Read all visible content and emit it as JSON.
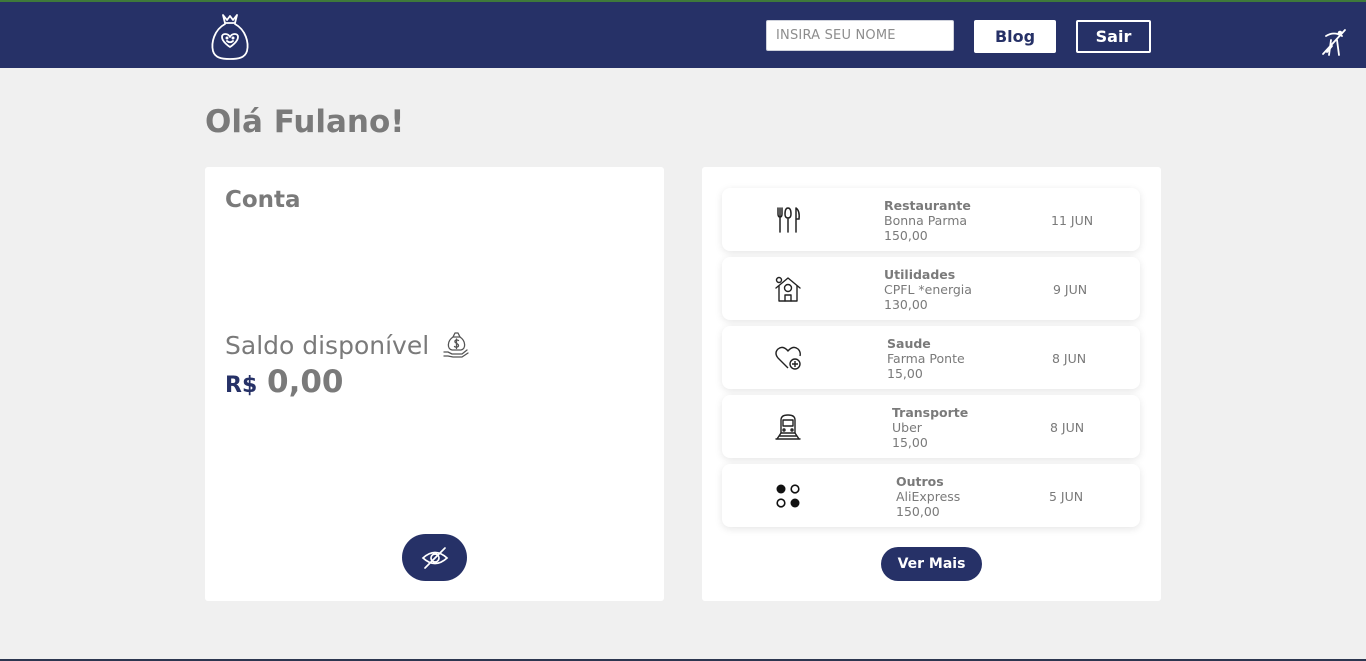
{
  "header": {
    "name_placeholder": "INSIRA SEU NOME",
    "blog_label": "Blog",
    "logout_label": "Sair",
    "logo_icon": "money-bag-heart-icon",
    "accessibility_icon": "accessibility-toggle-icon"
  },
  "greeting": "Olá Fulano!",
  "account": {
    "title": "Conta",
    "balance_label": "Saldo disponível",
    "balance_icon": "money-hand-icon",
    "currency": "R$",
    "balance": "0,00",
    "toggle_visibility_icon": "eye-off-icon"
  },
  "transactions": [
    {
      "category": "Restaurante",
      "name": "Bonna Parma",
      "value": "150,00",
      "date": "11 JUN",
      "icon": "fork-knife-icon"
    },
    {
      "category": "Utilidades",
      "name": "CPFL *energia",
      "value": "130,00",
      "date": "9 JUN",
      "icon": "house-money-icon"
    },
    {
      "category": "Saude",
      "name": "Farma Ponte",
      "value": "15,00",
      "date": "8 JUN",
      "icon": "heart-plus-icon"
    },
    {
      "category": "Transporte",
      "name": "Uber",
      "value": "15,00",
      "date": "8 JUN",
      "icon": "train-icon"
    },
    {
      "category": "Outros",
      "name": "AliExpress",
      "value": "150,00",
      "date": "5 JUN",
      "icon": "dots-icon"
    }
  ],
  "more_label": "Ver Mais",
  "colors": {
    "brand": "#263167",
    "text": "#7a7a7a",
    "background": "#f0f0f0"
  }
}
